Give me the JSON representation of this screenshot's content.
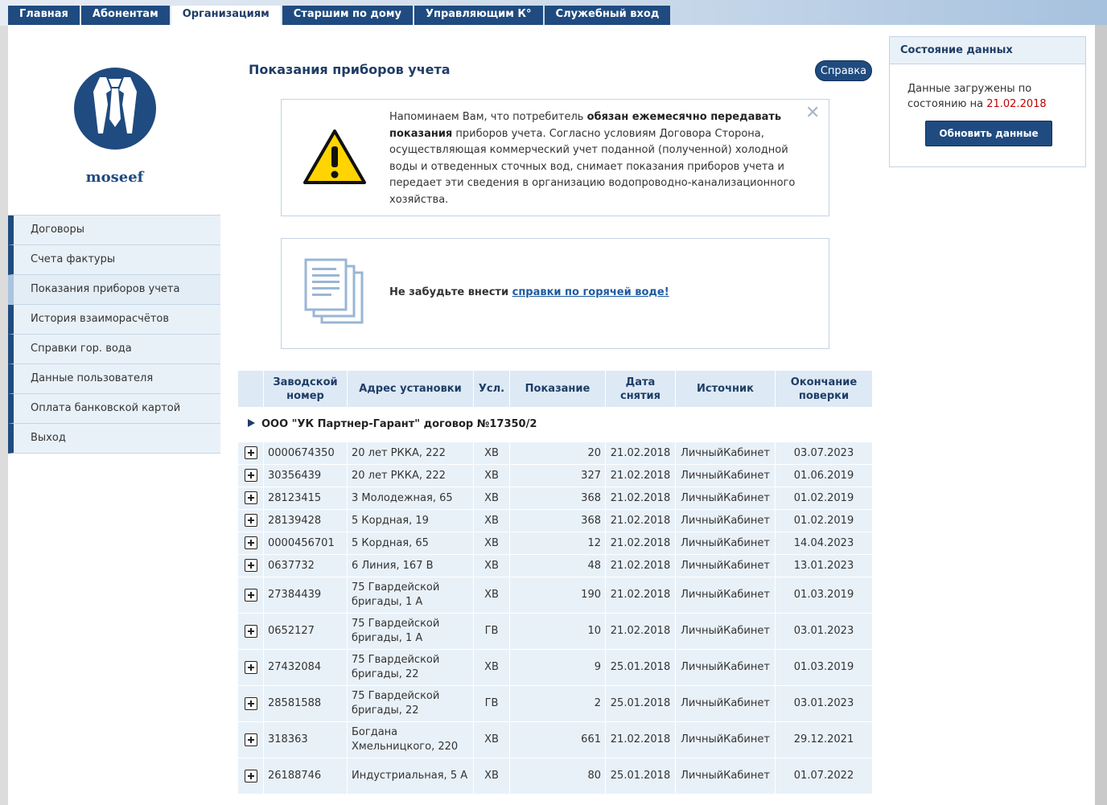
{
  "nav": {
    "tabs": [
      {
        "label": "Главная"
      },
      {
        "label": "Абонентам"
      },
      {
        "label": "Организациям"
      },
      {
        "label": "Старшим по дому"
      },
      {
        "label": "Управляющим К°"
      },
      {
        "label": "Служебный вход"
      }
    ]
  },
  "user": {
    "name": "moseef",
    "avatar_icon": "businessman-icon"
  },
  "sidebar": {
    "items": [
      {
        "label": "Договоры"
      },
      {
        "label": "Счета фактуры"
      },
      {
        "label": "Показания приборов учета"
      },
      {
        "label": "История взаиморасчётов"
      },
      {
        "label": "Справки гор. вода"
      },
      {
        "label": "Данные пользователя"
      },
      {
        "label": "Оплата банковской картой"
      },
      {
        "label": "Выход"
      }
    ]
  },
  "page": {
    "title": "Показания приборов учета",
    "help_label": "Справка"
  },
  "notice": {
    "icon": "warning-icon",
    "intro": "Напоминаем Вам, что потребитель ",
    "bold": "обязан ежемесячно передавать показания",
    "rest": " приборов учета. Согласно условиям Договора Сторона, осуществляющая коммерческий учет поданной (полученной) холодной воды и отведенных сточных вод, снимает показания приборов учета и передает эти сведения в организацию водопроводно-канализационного хозяйства.",
    "close": "✕"
  },
  "reminder": {
    "icon": "documents-icon",
    "text": "Не забудьте внести ",
    "link": "справки по горячей воде!"
  },
  "status": {
    "title": "Состояние данных",
    "text": "Данные загружены по состоянию на ",
    "date": "21.02.2018",
    "refresh_label": "Обновить данные"
  },
  "colors": {
    "brand": "#1f4b80",
    "row_bg": "#e9f1f8",
    "date_red": "#c00000"
  },
  "table": {
    "headers": [
      "Заводской номер",
      "Адрес установки",
      "Усл.",
      "Показание",
      "Дата снятия",
      "Источник",
      "Окончание поверки"
    ],
    "group": "ООО \"УК Партнер-Гарант\" договор №17350/2",
    "rows": [
      {
        "num": "0000674350",
        "addr": "20 лет РККА, 222",
        "svc": "ХВ",
        "val": "20",
        "date": "21.02.2018",
        "src": "ЛичныйКабинет",
        "end": "03.07.2023",
        "tall": false
      },
      {
        "num": "30356439",
        "addr": "20 лет РККА, 222",
        "svc": "ХВ",
        "val": "327",
        "date": "21.02.2018",
        "src": "ЛичныйКабинет",
        "end": "01.06.2019",
        "tall": false
      },
      {
        "num": "28123415",
        "addr": "3 Молодежная, 65",
        "svc": "ХВ",
        "val": "368",
        "date": "21.02.2018",
        "src": "ЛичныйКабинет",
        "end": "01.02.2019",
        "tall": false
      },
      {
        "num": "28139428",
        "addr": "5 Кордная, 19",
        "svc": "ХВ",
        "val": "368",
        "date": "21.02.2018",
        "src": "ЛичныйКабинет",
        "end": "01.02.2019",
        "tall": false
      },
      {
        "num": "0000456701",
        "addr": "5 Кордная, 65",
        "svc": "ХВ",
        "val": "12",
        "date": "21.02.2018",
        "src": "ЛичныйКабинет",
        "end": "14.04.2023",
        "tall": false
      },
      {
        "num": "0637732",
        "addr": "6 Линия, 167 В",
        "svc": "ХВ",
        "val": "48",
        "date": "21.02.2018",
        "src": "ЛичныйКабинет",
        "end": "13.01.2023",
        "tall": false
      },
      {
        "num": "27384439",
        "addr": "75 Гвардейской бригады, 1 А",
        "svc": "ХВ",
        "val": "190",
        "date": "21.02.2018",
        "src": "ЛичныйКабинет",
        "end": "01.03.2019",
        "tall": true
      },
      {
        "num": "0652127",
        "addr": "75 Гвардейской бригады, 1 А",
        "svc": "ГВ",
        "val": "10",
        "date": "21.02.2018",
        "src": "ЛичныйКабинет",
        "end": "03.01.2023",
        "tall": true
      },
      {
        "num": "27432084",
        "addr": "75 Гвардейской бригады, 22",
        "svc": "ХВ",
        "val": "9",
        "date": "25.01.2018",
        "src": "ЛичныйКабинет",
        "end": "01.03.2019",
        "tall": true
      },
      {
        "num": "28581588",
        "addr": "75 Гвардейской бригады, 22",
        "svc": "ГВ",
        "val": "2",
        "date": "25.01.2018",
        "src": "ЛичныйКабинет",
        "end": "03.01.2023",
        "tall": true
      },
      {
        "num": "318363",
        "addr": "Богдана Хмельницкого, 220",
        "svc": "ХВ",
        "val": "661",
        "date": "21.02.2018",
        "src": "ЛичныйКабинет",
        "end": "29.12.2021",
        "tall": true
      },
      {
        "num": "26188746",
        "addr": "Индустриальная, 5 А",
        "svc": "ХВ",
        "val": "80",
        "date": "25.01.2018",
        "src": "ЛичныйКабинет",
        "end": "01.07.2022",
        "tall": true
      }
    ]
  }
}
